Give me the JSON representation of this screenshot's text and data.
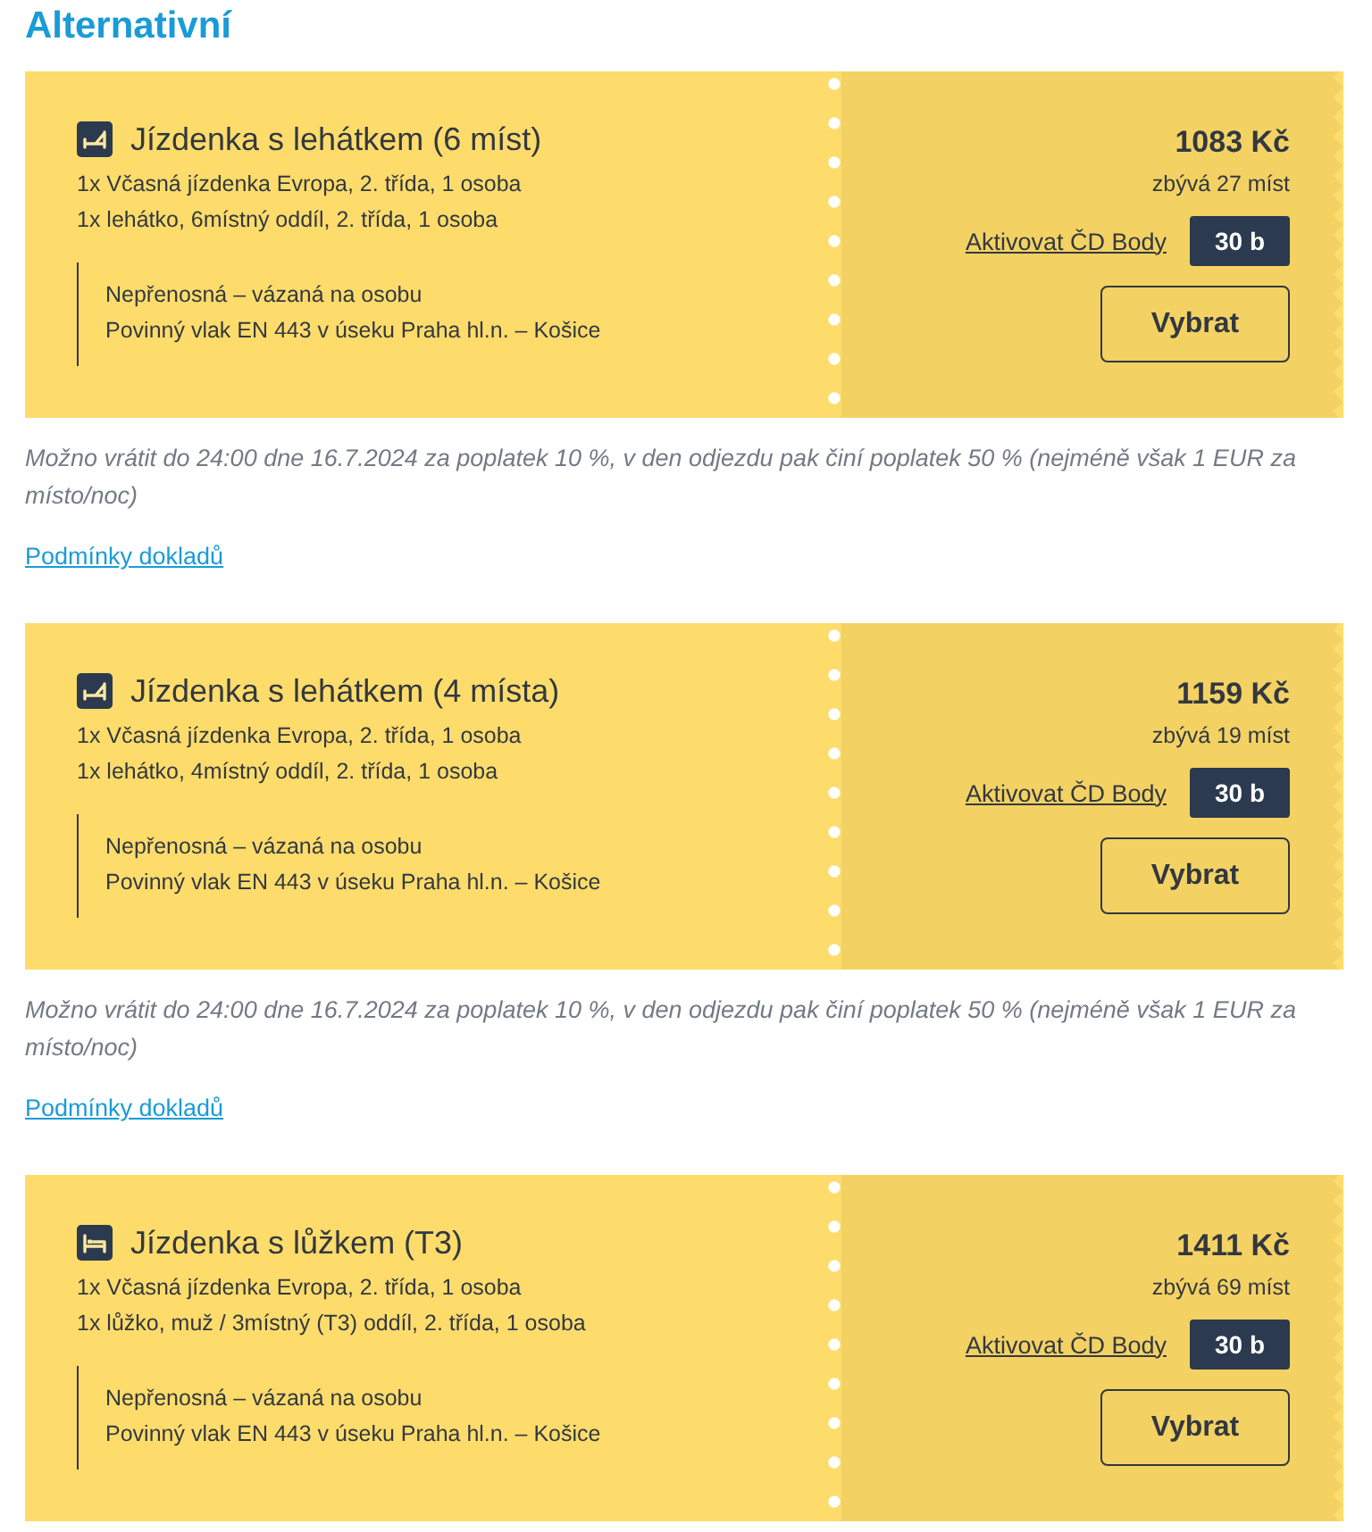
{
  "section_title": "Alternativní",
  "offers": [
    {
      "kind": "couchette",
      "title": "Jízdenka s lehátkem (6 míst)",
      "items": [
        "1x Včasná jízdenka Evropa, 2. třída, 1 osoba",
        "1x lehátko, 6místný oddíl, 2. třída, 1 osoba"
      ],
      "conditions": [
        "Nepřenosná – vázaná na osobu",
        "Povinný vlak EN 443 v úseku Praha hl.n. – Košice"
      ],
      "price": "1083 Kč",
      "availability": "zbývá 27 míst",
      "points_link": "Aktivovat ČD Body",
      "points_badge": "30 b",
      "select_button": "Vybrat",
      "refund_note": "Možno vrátit do 24:00 dne 16.7.2024 za poplatek 10 %, v den odjezdu pak činí poplatek 50 % (nejméně však 1 EUR za místo/noc)",
      "terms_link": "Podmínky dokladů"
    },
    {
      "kind": "couchette",
      "title": "Jízdenka s lehátkem (4 místa)",
      "items": [
        "1x Včasná jízdenka Evropa, 2. třída, 1 osoba",
        "1x lehátko, 4místný oddíl, 2. třída, 1 osoba"
      ],
      "conditions": [
        "Nepřenosná – vázaná na osobu",
        "Povinný vlak EN 443 v úseku Praha hl.n. – Košice"
      ],
      "price": "1159 Kč",
      "availability": "zbývá 19 míst",
      "points_link": "Aktivovat ČD Body",
      "points_badge": "30 b",
      "select_button": "Vybrat",
      "refund_note": "Možno vrátit do 24:00 dne 16.7.2024 za poplatek 10 %, v den odjezdu pak činí poplatek 50 % (nejméně však 1 EUR za místo/noc)",
      "terms_link": "Podmínky dokladů"
    },
    {
      "kind": "bed",
      "title": "Jízdenka s lůžkem (T3)",
      "items": [
        "1x Včasná jízdenka Evropa, 2. třída, 1 osoba",
        "1x lůžko, muž / 3místný (T3) oddíl, 2. třída, 1 osoba"
      ],
      "conditions": [
        "Nepřenosná – vázaná na osobu",
        "Povinný vlak EN 443 v úseku Praha hl.n. – Košice"
      ],
      "price": "1411 Kč",
      "availability": "zbývá 69 míst",
      "points_link": "Aktivovat ČD Body",
      "points_badge": "30 b",
      "select_button": "Vybrat"
    }
  ]
}
